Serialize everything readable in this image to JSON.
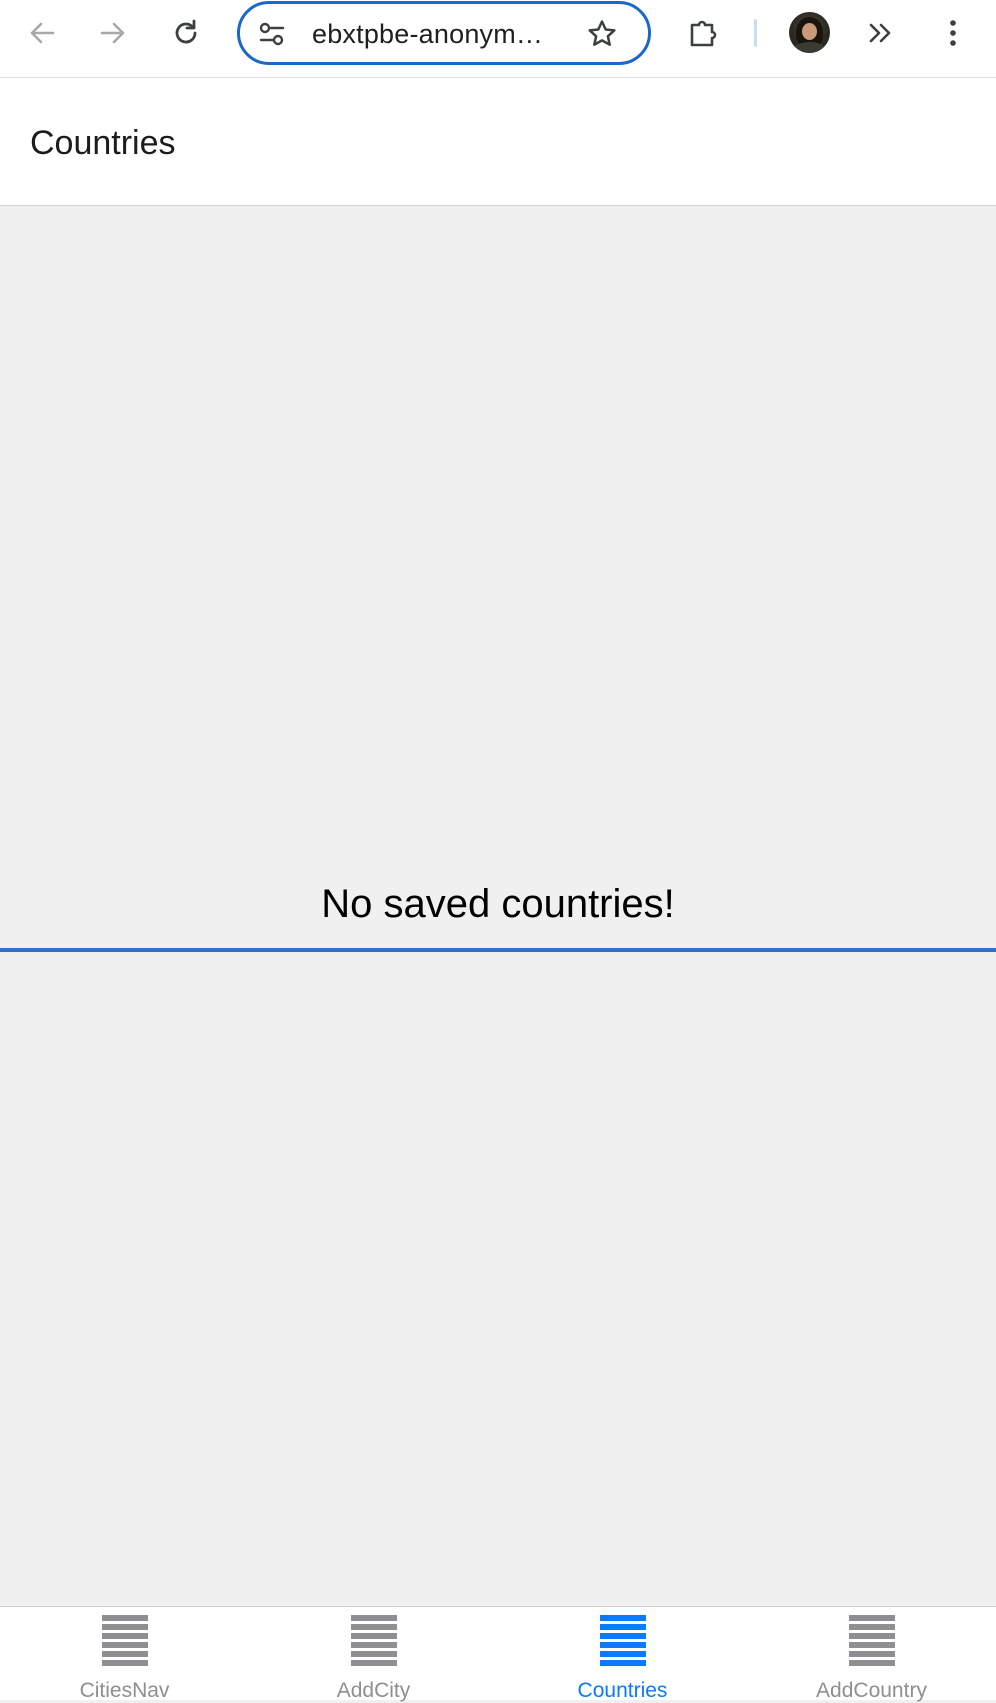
{
  "browser": {
    "url": "ebxtpbe-anonym…",
    "icons": {
      "back": "arrow-left-icon",
      "forward": "arrow-right-icon",
      "reload": "reload-icon",
      "site_info": "tune-icon",
      "bookmark": "star-outline-icon",
      "extensions": "puzzle-piece-icon",
      "overflow": "double-chevron-right-icon",
      "menu": "vertical-dots-icon"
    }
  },
  "header": {
    "title": "Countries"
  },
  "main": {
    "empty_message": "No saved countries!"
  },
  "tabs": [
    {
      "label": "CitiesNav",
      "icon": "list-icon",
      "active": false
    },
    {
      "label": "AddCity",
      "icon": "list-icon",
      "active": false
    },
    {
      "label": "Countries",
      "icon": "list-icon",
      "active": true
    },
    {
      "label": "AddCountry",
      "icon": "list-icon",
      "active": false
    }
  ],
  "colors": {
    "accent": "#0a7aff",
    "inactive_tab": "#8e8e93",
    "focus_ring": "#1a68c9",
    "content_bg": "#f0f0f0"
  }
}
